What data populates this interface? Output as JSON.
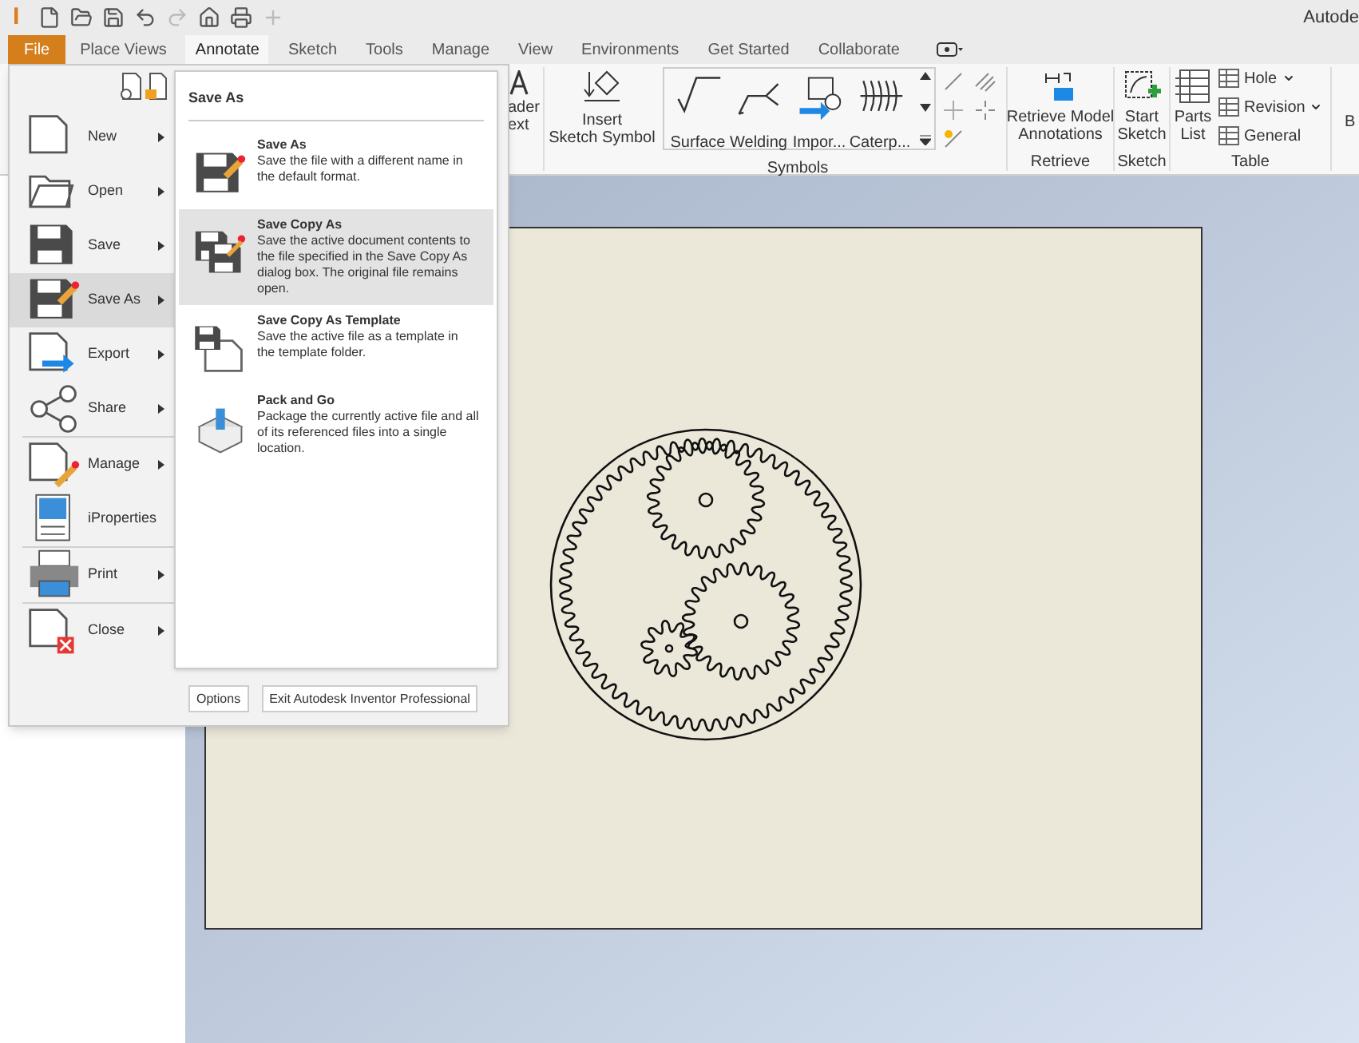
{
  "app": {
    "logo": "I",
    "title": "Autode"
  },
  "tabs": [
    {
      "label": "File",
      "kind": "file",
      "selected": false
    },
    {
      "label": "Place Views",
      "kind": "tab",
      "selected": false
    },
    {
      "label": "Annotate",
      "kind": "tab",
      "selected": true
    },
    {
      "label": "Sketch",
      "kind": "tab",
      "selected": false
    },
    {
      "label": "Tools",
      "kind": "tab",
      "selected": false
    },
    {
      "label": "Manage",
      "kind": "tab",
      "selected": false
    },
    {
      "label": "View",
      "kind": "tab",
      "selected": false
    },
    {
      "label": "Environments",
      "kind": "tab",
      "selected": false
    },
    {
      "label": "Get Started",
      "kind": "tab",
      "selected": false
    },
    {
      "label": "Collaborate",
      "kind": "tab",
      "selected": false
    }
  ],
  "ribbon": {
    "cut_button_lines": [
      "ader",
      "ext"
    ],
    "insert_button": {
      "lines": [
        "Insert",
        "Sketch Symbol"
      ]
    },
    "symbols": {
      "group_label": "Symbols",
      "items": [
        {
          "label": "Surface",
          "kind": "surface"
        },
        {
          "label": "Welding",
          "kind": "welding"
        },
        {
          "label": "Impor...",
          "kind": "import"
        },
        {
          "label": "Caterp...",
          "kind": "caterpillar"
        }
      ]
    },
    "retrieve": {
      "lines": [
        "Retrieve Model",
        "Annotations"
      ],
      "group_label": "Retrieve"
    },
    "sketch": {
      "lines": [
        "Start",
        "Sketch"
      ],
      "group_label": "Sketch"
    },
    "table": {
      "group_label": "Table",
      "parts_list": [
        "Parts",
        "List"
      ],
      "items": [
        {
          "label": "Hole",
          "dropdown": true
        },
        {
          "label": "Revision",
          "dropdown": true
        },
        {
          "label": "General",
          "dropdown": false
        }
      ]
    },
    "cut_right": "B"
  },
  "file_menu": {
    "item_groups": [
      [
        {
          "label": "New",
          "kind": "new",
          "submenu": true,
          "selected": false
        },
        {
          "label": "Open",
          "kind": "open",
          "submenu": true,
          "selected": false
        },
        {
          "label": "Save",
          "kind": "save",
          "submenu": true,
          "selected": false
        },
        {
          "label": "Save As",
          "kind": "saveas",
          "submenu": true,
          "selected": true
        },
        {
          "label": "Export",
          "kind": "export",
          "submenu": true,
          "selected": false
        },
        {
          "label": "Share",
          "kind": "share",
          "submenu": true,
          "selected": false
        }
      ],
      [
        {
          "label": "Manage",
          "kind": "manage",
          "submenu": true,
          "selected": false
        },
        {
          "label": "iProperties",
          "kind": "iprops",
          "submenu": false,
          "selected": false
        }
      ],
      [
        {
          "label": "Print",
          "kind": "print",
          "submenu": true,
          "selected": false
        }
      ],
      [
        {
          "label": "Close",
          "kind": "close",
          "submenu": true,
          "selected": false
        }
      ]
    ],
    "panel": {
      "title": "Save As",
      "entries": [
        {
          "title": "Save As",
          "description": "Save the file with a different name in the default format.",
          "kind": "saveas",
          "selected": false
        },
        {
          "title": "Save Copy As",
          "description": "Save the active document contents to the file specified in the Save Copy As dialog box. The original file remains open.",
          "kind": "savecopy",
          "selected": true
        },
        {
          "title": "Save Copy As Template",
          "description": "Save the active file as a template in the template folder.",
          "kind": "template",
          "selected": false
        },
        {
          "title": "Pack and Go",
          "description": "Package the currently active file and all of its referenced files into a single location.",
          "kind": "pack",
          "selected": false
        }
      ]
    },
    "buttons": [
      "Options",
      "Exit Autodesk Inventor Professional"
    ]
  }
}
